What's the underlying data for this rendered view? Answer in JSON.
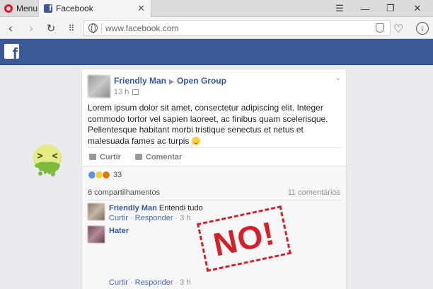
{
  "browser": {
    "menu_label": "Menu",
    "tab_title": "Facebook",
    "url": "www.facebook.com"
  },
  "post": {
    "author": "Friendly Man",
    "group": "Open Group",
    "time": "13 h",
    "text": "Lorem ipsum dolor sit amet, consectetur adipiscing elit. Integer commodo tortor vel sapien laoreet, ac finibus quam scelerisque. Pellentesque habitant morbi tristique senectus et netus et malesuada fames ac turpis",
    "like_label": "Curtir",
    "comment_label": "Comentar",
    "reaction_count": "33",
    "shares": "6 compartilhamentos",
    "comments_count": "11 comentários"
  },
  "comments": [
    {
      "author": "Friendly Man",
      "text": "Entendi tudo",
      "like_label": "Curtir",
      "reply_label": "Responder",
      "time": "3 h"
    },
    {
      "author": "Hater",
      "text": "",
      "like_label": "Curtir",
      "reply_label": "Responder",
      "time": "3 h"
    }
  ],
  "stamp": {
    "text": "NO!",
    "color": "#d42026"
  },
  "colors": {
    "facebook_blue": "#3b5998",
    "link_blue": "#365899"
  }
}
